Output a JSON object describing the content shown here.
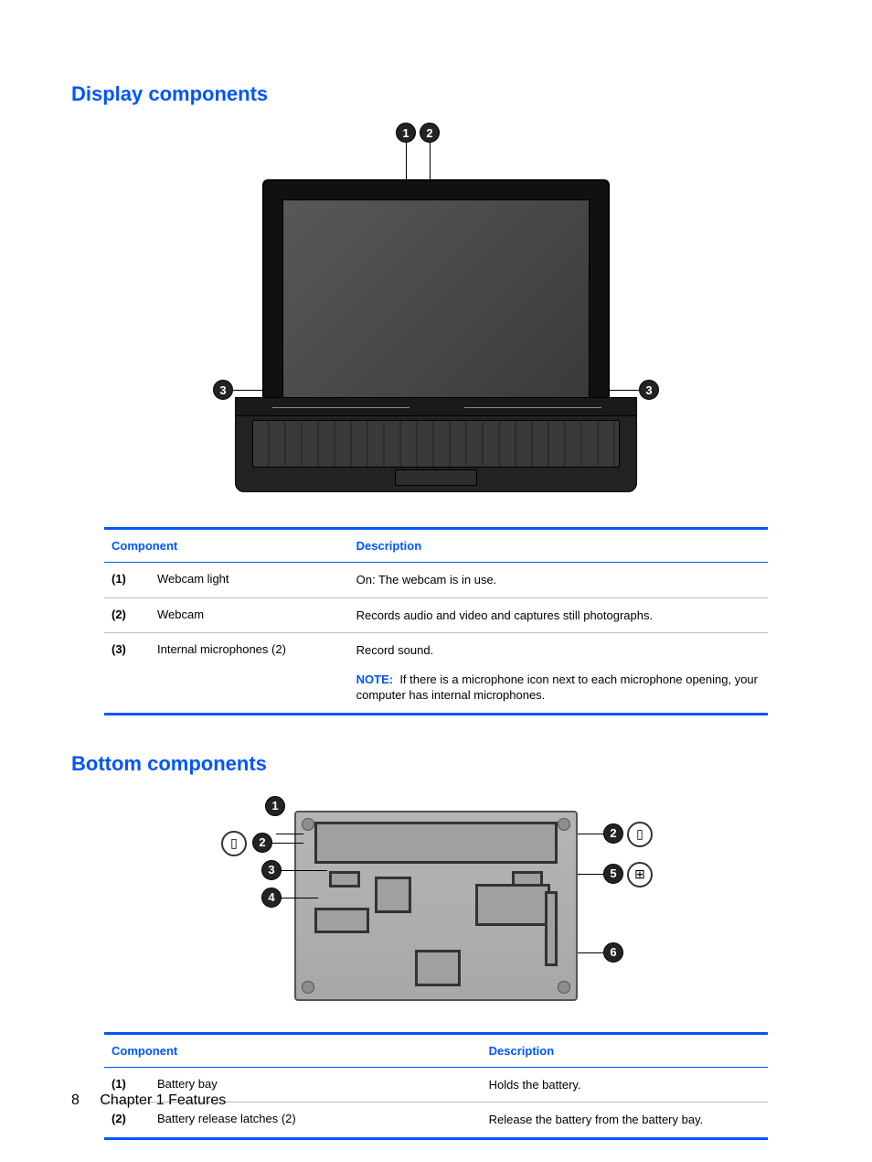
{
  "section1": {
    "heading": "Display components",
    "table": {
      "headers": {
        "component": "Component",
        "description": "Description"
      },
      "rows": [
        {
          "idx": "(1)",
          "name": "Webcam light",
          "desc": "On: The webcam is in use.",
          "note": null
        },
        {
          "idx": "(2)",
          "name": "Webcam",
          "desc": "Records audio and video and captures still photographs.",
          "note": null
        },
        {
          "idx": "(3)",
          "name": "Internal microphones (2)",
          "desc": "Record sound.",
          "note": "If there is a microphone icon next to each microphone opening, your computer has internal microphones."
        }
      ],
      "note_label": "NOTE:"
    }
  },
  "section2": {
    "heading": "Bottom components",
    "table": {
      "headers": {
        "component": "Component",
        "description": "Description"
      },
      "rows": [
        {
          "idx": "(1)",
          "name": "Battery bay",
          "desc": "Holds the battery."
        },
        {
          "idx": "(2)",
          "name": "Battery release latches (2)",
          "desc": "Release the battery from the battery bay."
        }
      ]
    }
  },
  "footer": {
    "page": "8",
    "chapter": "Chapter 1   Features"
  }
}
